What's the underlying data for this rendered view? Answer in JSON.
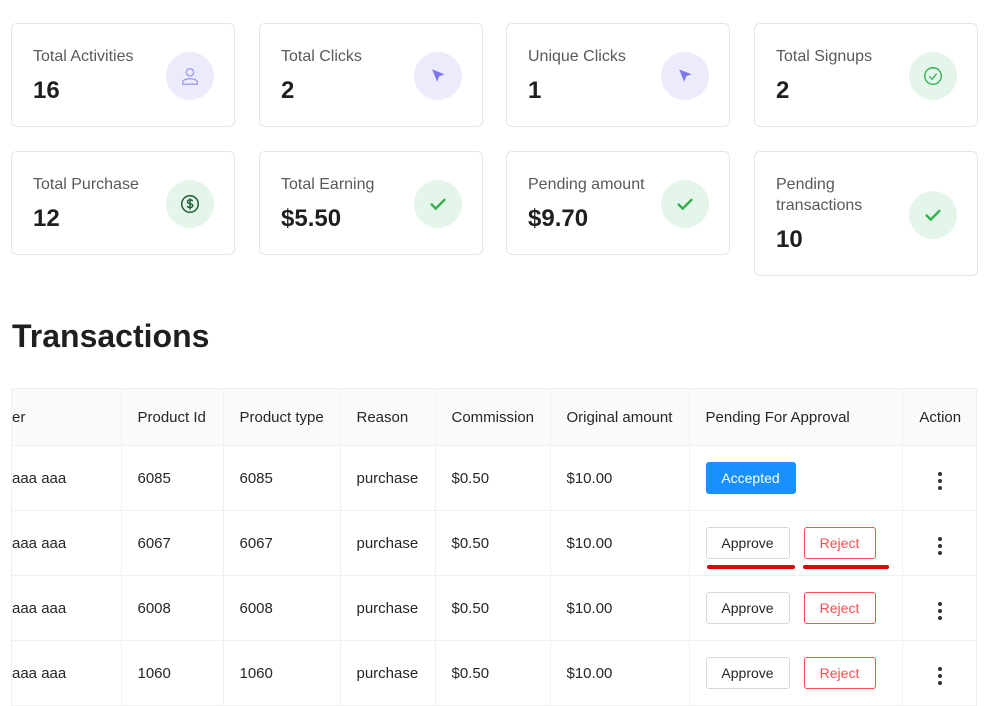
{
  "stats": [
    {
      "label": "Total Activities",
      "value": "16",
      "icon": "user-icon",
      "tone": "purple"
    },
    {
      "label": "Total Clicks",
      "value": "2",
      "icon": "cursor-icon",
      "tone": "purple"
    },
    {
      "label": "Unique Clicks",
      "value": "1",
      "icon": "cursor-icon",
      "tone": "purple"
    },
    {
      "label": "Total Signups",
      "value": "2",
      "icon": "check-circle-icon",
      "tone": "green"
    },
    {
      "label": "Total Purchase",
      "value": "12",
      "icon": "dollar-circle-icon",
      "tone": "green"
    },
    {
      "label": "Total Earning",
      "value": "$5.50",
      "icon": "check-icon",
      "tone": "green"
    },
    {
      "label": "Pending amount",
      "value": "$9.70",
      "icon": "check-icon",
      "tone": "green"
    },
    {
      "label": "Pending transactions",
      "value": "10",
      "icon": "check-icon",
      "tone": "green"
    }
  ],
  "colors": {
    "purple_icon": "#8b85f0",
    "green_icon": "#3bb55a",
    "primary": "#1890ff",
    "danger": "#ff4d4f",
    "annotation": "#e00000"
  },
  "transactions": {
    "title": "Transactions",
    "columns": [
      "er",
      "Product Id",
      "Product type",
      "Reason",
      "Commission",
      "Original amount",
      "Pending For Approval",
      "Action"
    ],
    "rows": [
      {
        "user": "aaa aaa",
        "product_id": "6085",
        "product_type": "6085",
        "reason": "purchase",
        "commission": "$0.50",
        "original_amount": "$10.00",
        "status": "accepted"
      },
      {
        "user": "aaa aaa",
        "product_id": "6067",
        "product_type": "6067",
        "reason": "purchase",
        "commission": "$0.50",
        "original_amount": "$10.00",
        "status": "pending"
      },
      {
        "user": "aaa aaa",
        "product_id": "6008",
        "product_type": "6008",
        "reason": "purchase",
        "commission": "$0.50",
        "original_amount": "$10.00",
        "status": "pending"
      },
      {
        "user": "aaa aaa",
        "product_id": "1060",
        "product_type": "1060",
        "reason": "purchase",
        "commission": "$0.50",
        "original_amount": "$10.00",
        "status": "pending"
      }
    ],
    "accepted_label": "Accepted",
    "approve_label": "Approve",
    "reject_label": "Reject"
  }
}
